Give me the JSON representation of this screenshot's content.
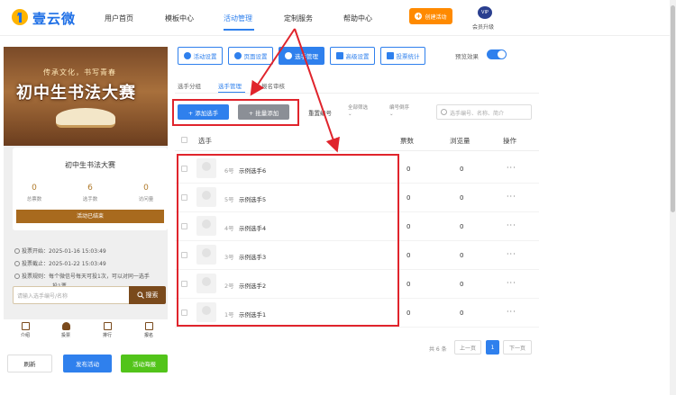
{
  "brand": {
    "name": "壹云微"
  },
  "nav": {
    "items": [
      {
        "label": "用户首页"
      },
      {
        "label": "模板中心"
      },
      {
        "label": "活动管理"
      },
      {
        "label": "定制服务"
      },
      {
        "label": "帮助中心"
      }
    ],
    "active_index": 2,
    "create_label": "创建活动",
    "vip_badge": "VIP",
    "vip_label": "会员升级"
  },
  "preview": {
    "banner_subtitle": "传承文化，书写青春",
    "banner_title": "初中生书法大赛",
    "card_title": "初中生书法大赛",
    "stats": [
      {
        "value": "0",
        "label": "总票数"
      },
      {
        "value": "6",
        "label": "选手数"
      },
      {
        "value": "0",
        "label": "访问量"
      }
    ],
    "status_bar": "活动已结束",
    "info": [
      "投票开始：2025-01-16 15:03:49",
      "投票截止：2025-01-22 15:03:49",
      "投票规则：每个微信号每天可投1次，可以对同一选手",
      "投1票"
    ],
    "search_placeholder": "请输入选手编号/名称",
    "search_button": "搜索",
    "tabs": [
      {
        "label": "介绍"
      },
      {
        "label": "投票"
      },
      {
        "label": "排行"
      },
      {
        "label": "报名"
      }
    ]
  },
  "bottom_buttons": {
    "refresh": "刷新",
    "publish": "发布活动",
    "poster": "活动海报"
  },
  "toolbar": [
    {
      "label": "活动设置",
      "icon": "gear-icon"
    },
    {
      "label": "页面设置",
      "icon": "page-icon"
    },
    {
      "label": "选手管理",
      "icon": "users-icon"
    },
    {
      "label": "高级设置",
      "icon": "advanced-icon"
    },
    {
      "label": "投票统计",
      "icon": "chart-icon"
    }
  ],
  "toolbar_active": 2,
  "preview_toggle": {
    "label": "预览效果",
    "on": true
  },
  "subtabs": [
    {
      "label": "选手分组"
    },
    {
      "label": "选手管理"
    },
    {
      "label": "报名审核"
    }
  ],
  "actions": {
    "add": "+ 添加选手",
    "batch": "+ 批量添加",
    "sort_number": "重置编号",
    "filter_all": "全部筛选",
    "filter_order": "编号倒序",
    "search_placeholder": "选手编号、名称、简介"
  },
  "table": {
    "headers": {
      "player": "选手",
      "votes": "票数",
      "views": "浏览量",
      "ops": "操作"
    },
    "rows": [
      {
        "num": "6号",
        "name": "示例选手6",
        "votes": "0",
        "views": "0",
        "more": "···"
      },
      {
        "num": "5号",
        "name": "示例选手5",
        "votes": "0",
        "views": "0",
        "more": "···"
      },
      {
        "num": "4号",
        "name": "示例选手4",
        "votes": "0",
        "views": "0",
        "more": "···"
      },
      {
        "num": "3号",
        "name": "示例选手3",
        "votes": "0",
        "views": "0",
        "more": "···"
      },
      {
        "num": "2号",
        "name": "示例选手2",
        "votes": "0",
        "views": "0",
        "more": "···"
      },
      {
        "num": "1号",
        "name": "示例选手1",
        "votes": "0",
        "views": "0",
        "more": "···"
      }
    ]
  },
  "pagination": {
    "total": "共 6 条",
    "prev": "上一页",
    "current": "1",
    "next": "下一页"
  },
  "colors": {
    "accent": "#2f80ed",
    "annotation": "#e0242c",
    "create": "#ff8a00",
    "poster": "#52c41a",
    "theme": "#7a4a1c"
  }
}
